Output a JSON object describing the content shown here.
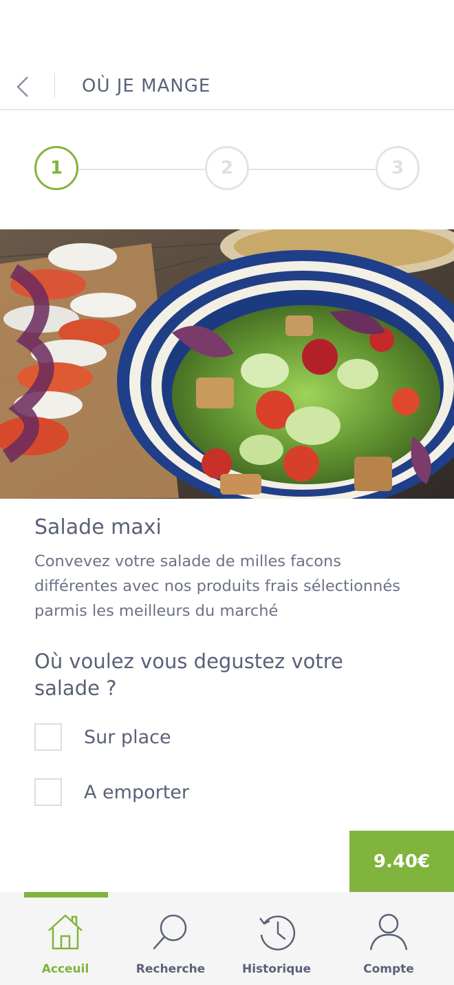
{
  "header": {
    "title": "OÙ JE MANGE"
  },
  "stepper": {
    "steps": [
      "1",
      "2",
      "3"
    ],
    "active_step": 1
  },
  "product": {
    "title": "Salade maxi",
    "description_lines": [
      "Convevez votre  salade de milles facons",
      "différentes avec nos produits frais sélectionnés",
      "parmis les meilleurs du marché"
    ]
  },
  "question": {
    "lines": [
      "Où voulez vous degustez votre",
      "salade ?"
    ]
  },
  "options": [
    {
      "label": "Sur place",
      "checked": false
    },
    {
      "label": "A emporter",
      "checked": false
    }
  ],
  "price": "9.40€",
  "tabs": [
    {
      "label": "Acceuil",
      "icon": "home-icon",
      "active": true
    },
    {
      "label": "Recherche",
      "icon": "search-icon",
      "active": false
    },
    {
      "label": "Historique",
      "icon": "history-icon",
      "active": false
    },
    {
      "label": "Compte",
      "icon": "user-icon",
      "active": false
    }
  ],
  "colors": {
    "accent": "#80b43c",
    "text": "#5a6178",
    "tabbar_bg": "#f5f5f5"
  }
}
